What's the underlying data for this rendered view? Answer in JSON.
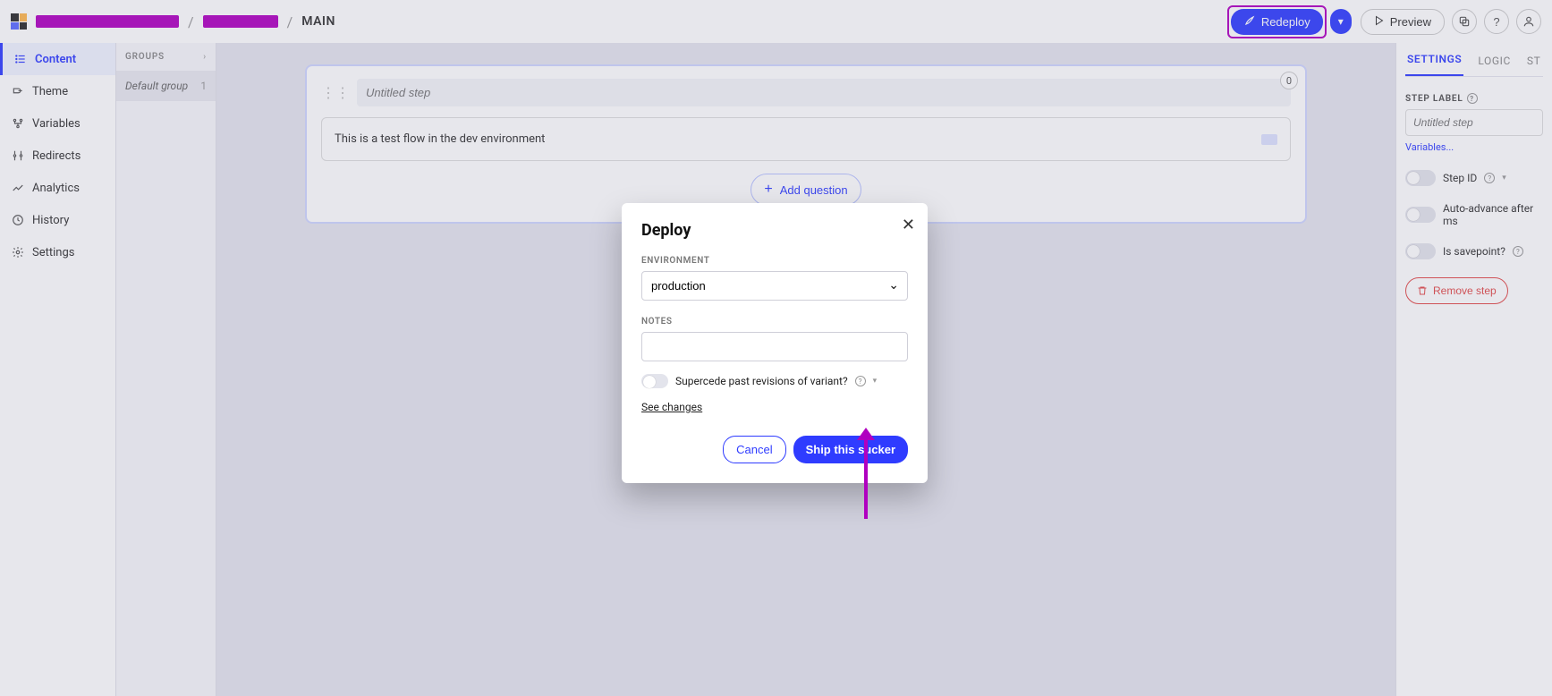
{
  "header": {
    "breadcrumb_main": "MAIN",
    "redeploy_label": "Redeploy",
    "preview_label": "Preview"
  },
  "sidebar": {
    "items": [
      {
        "label": "Content"
      },
      {
        "label": "Theme"
      },
      {
        "label": "Variables"
      },
      {
        "label": "Redirects"
      },
      {
        "label": "Analytics"
      },
      {
        "label": "History"
      },
      {
        "label": "Settings"
      }
    ]
  },
  "groups": {
    "header": "GROUPS",
    "items": [
      {
        "name": "Default group",
        "count": "1"
      }
    ]
  },
  "step": {
    "badge": "0",
    "title_placeholder": "Untitled step",
    "question_text": "This is a test flow in the dev environment",
    "add_question_label": "Add question"
  },
  "rightpanel": {
    "tabs": [
      {
        "label": "SETTINGS"
      },
      {
        "label": "LOGIC"
      },
      {
        "label": "ST"
      }
    ],
    "step_label_heading": "STEP LABEL",
    "step_label_placeholder": "Untitled step",
    "variables_link": "Variables...",
    "toggles": [
      {
        "label": "Step ID"
      },
      {
        "label": "Auto-advance after ms"
      },
      {
        "label": "Is savepoint?"
      }
    ],
    "remove_label": "Remove step"
  },
  "modal": {
    "title": "Deploy",
    "env_label": "ENVIRONMENT",
    "env_value": "production",
    "notes_label": "NOTES",
    "notes_value": "",
    "supersede_label": "Supercede past revisions of variant?",
    "see_changes": "See changes",
    "cancel": "Cancel",
    "ship": "Ship this sucker"
  }
}
